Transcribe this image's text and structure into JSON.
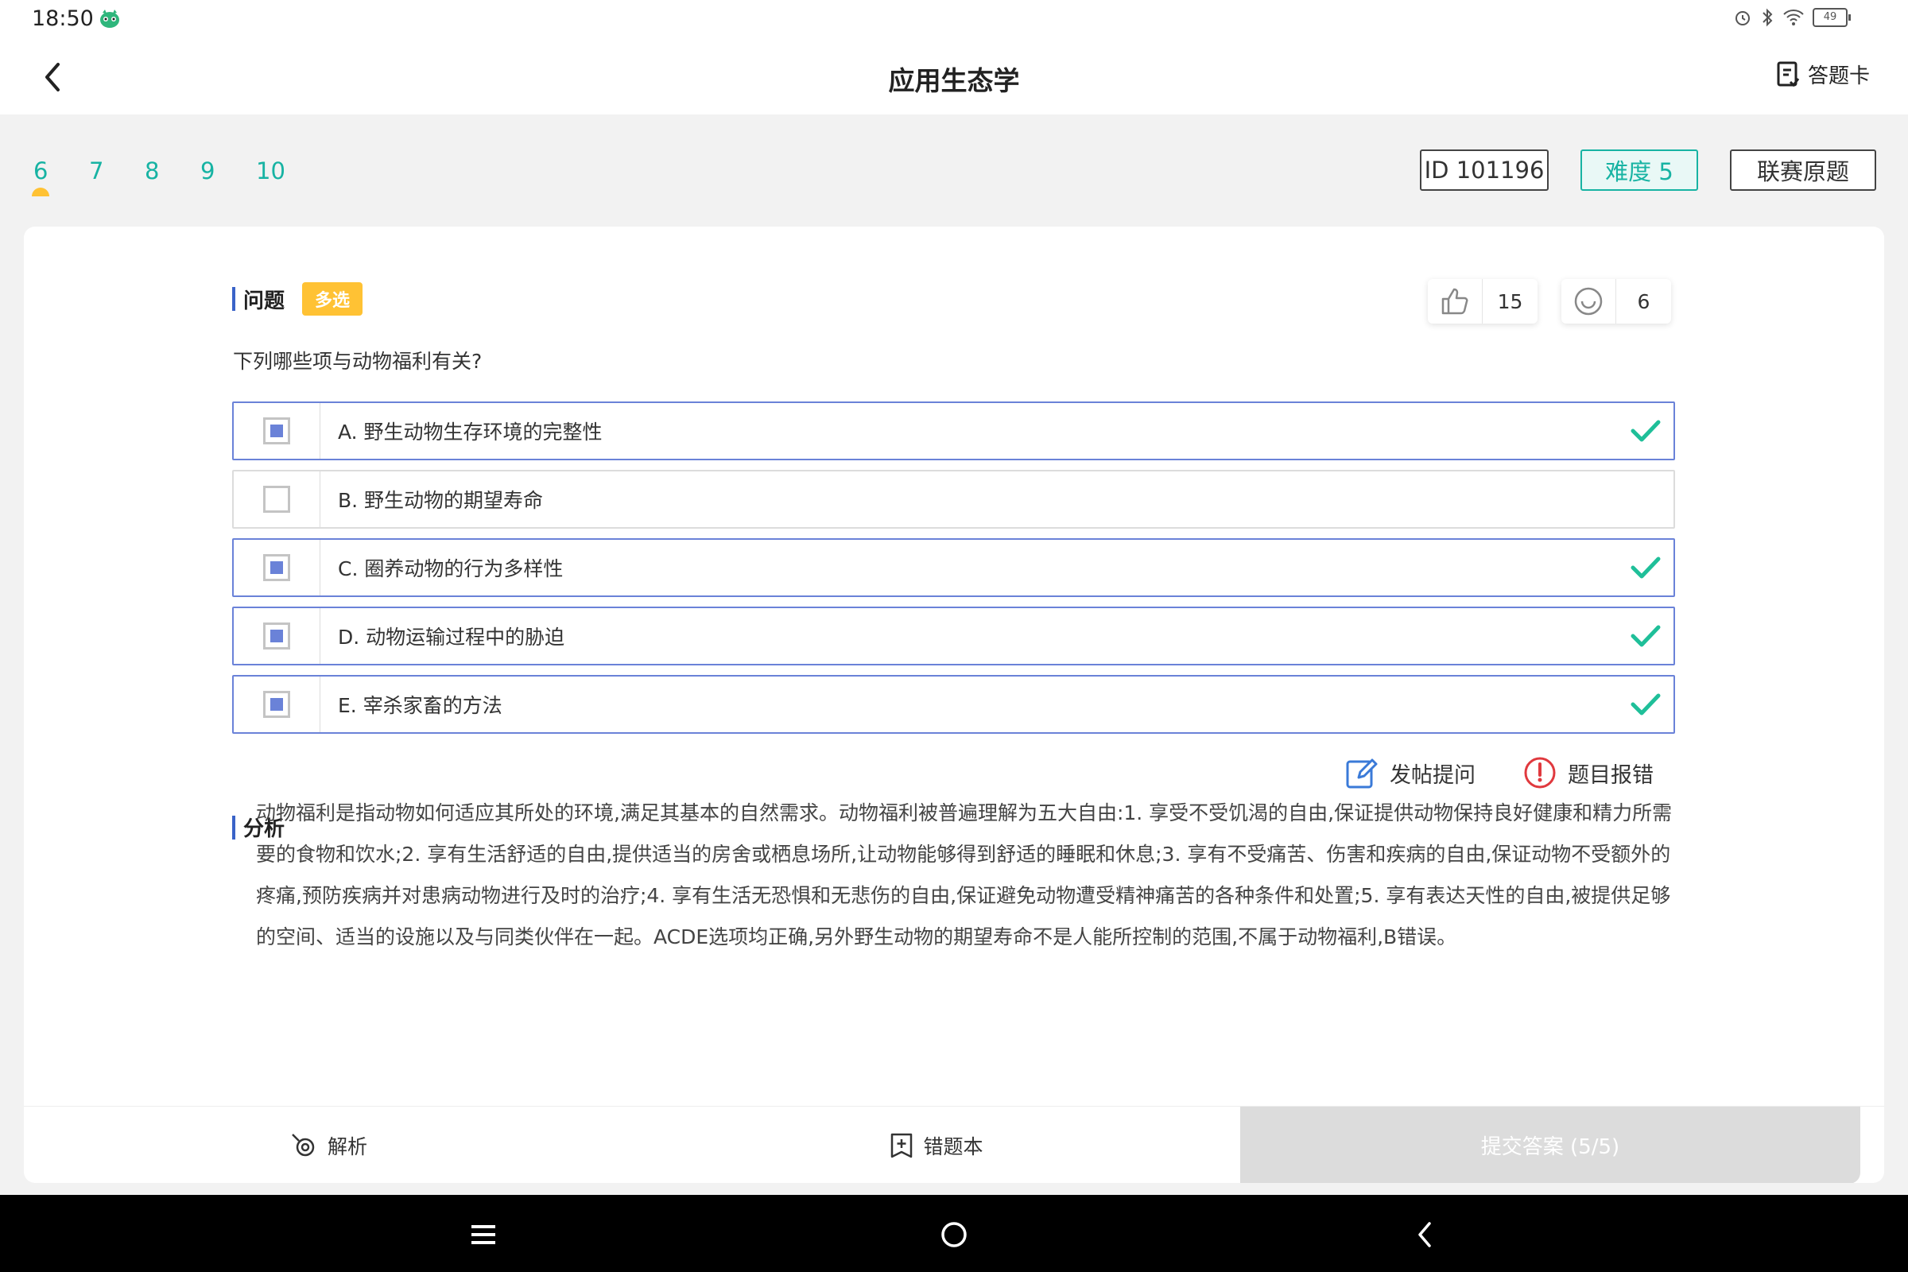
{
  "status": {
    "time": "18:50",
    "battery": "49"
  },
  "header": {
    "title": "应用生态学",
    "answer_card_label": "答题卡"
  },
  "question_nav": [
    "6",
    "7",
    "8",
    "9",
    "10"
  ],
  "tags": {
    "id": "ID 101196",
    "difficulty": "难度 5",
    "origin": "联赛原题"
  },
  "question": {
    "section_label": "问题",
    "type_badge": "多选",
    "likes": "15",
    "comments": "6",
    "text": "下列哪些项与动物福利有关?"
  },
  "options": [
    {
      "label": "A. 野生动物生存环境的完整性",
      "checked": true,
      "correct": true
    },
    {
      "label": "B. 野生动物的期望寿命",
      "checked": false,
      "correct": false
    },
    {
      "label": "C. 圈养动物的行为多样性",
      "checked": true,
      "correct": true
    },
    {
      "label": "D. 动物运输过程中的胁迫",
      "checked": true,
      "correct": true
    },
    {
      "label": "E. 宰杀家畜的方法",
      "checked": true,
      "correct": true
    }
  ],
  "actions": {
    "post_question": "发帖提问",
    "report_error": "题目报错"
  },
  "analysis": {
    "section_label": "分析",
    "text": "动物福利是指动物如何适应其所处的环境,满足其基本的自然需求。动物福利被普遍理解为五大自由:1. 享受不受饥渴的自由,保证提供动物保持良好健康和精力所需要的食物和饮水;2. 享有生活舒适的自由,提供适当的房舍或栖息场所,让动物能够得到舒适的睡眠和休息;3. 享有不受痛苦、伤害和疾病的自由,保证动物不受额外的疼痛,预防疾病并对患病动物进行及时的治疗;4. 享有生活无恐惧和无悲伤的自由,保证避免动物遭受精神痛苦的各种条件和处置;5. 享有表达天性的自由,被提供足够的空间、适当的设施以及与同类伙伴在一起。ACDE选项均正确,另外野生动物的期望寿命不是人能所控制的范围,不属于动物福利,B错误。"
  },
  "bottom": {
    "analysis_tab": "解析",
    "wrongbook_tab": "错题本",
    "submit": "提交答案 (5/5)"
  },
  "colors": {
    "accent_teal": "#17b3a3",
    "option_border": "#6a82d8",
    "badge_yellow": "#ffc234",
    "check_green": "#1fbf99",
    "error_red": "#e0393e"
  }
}
